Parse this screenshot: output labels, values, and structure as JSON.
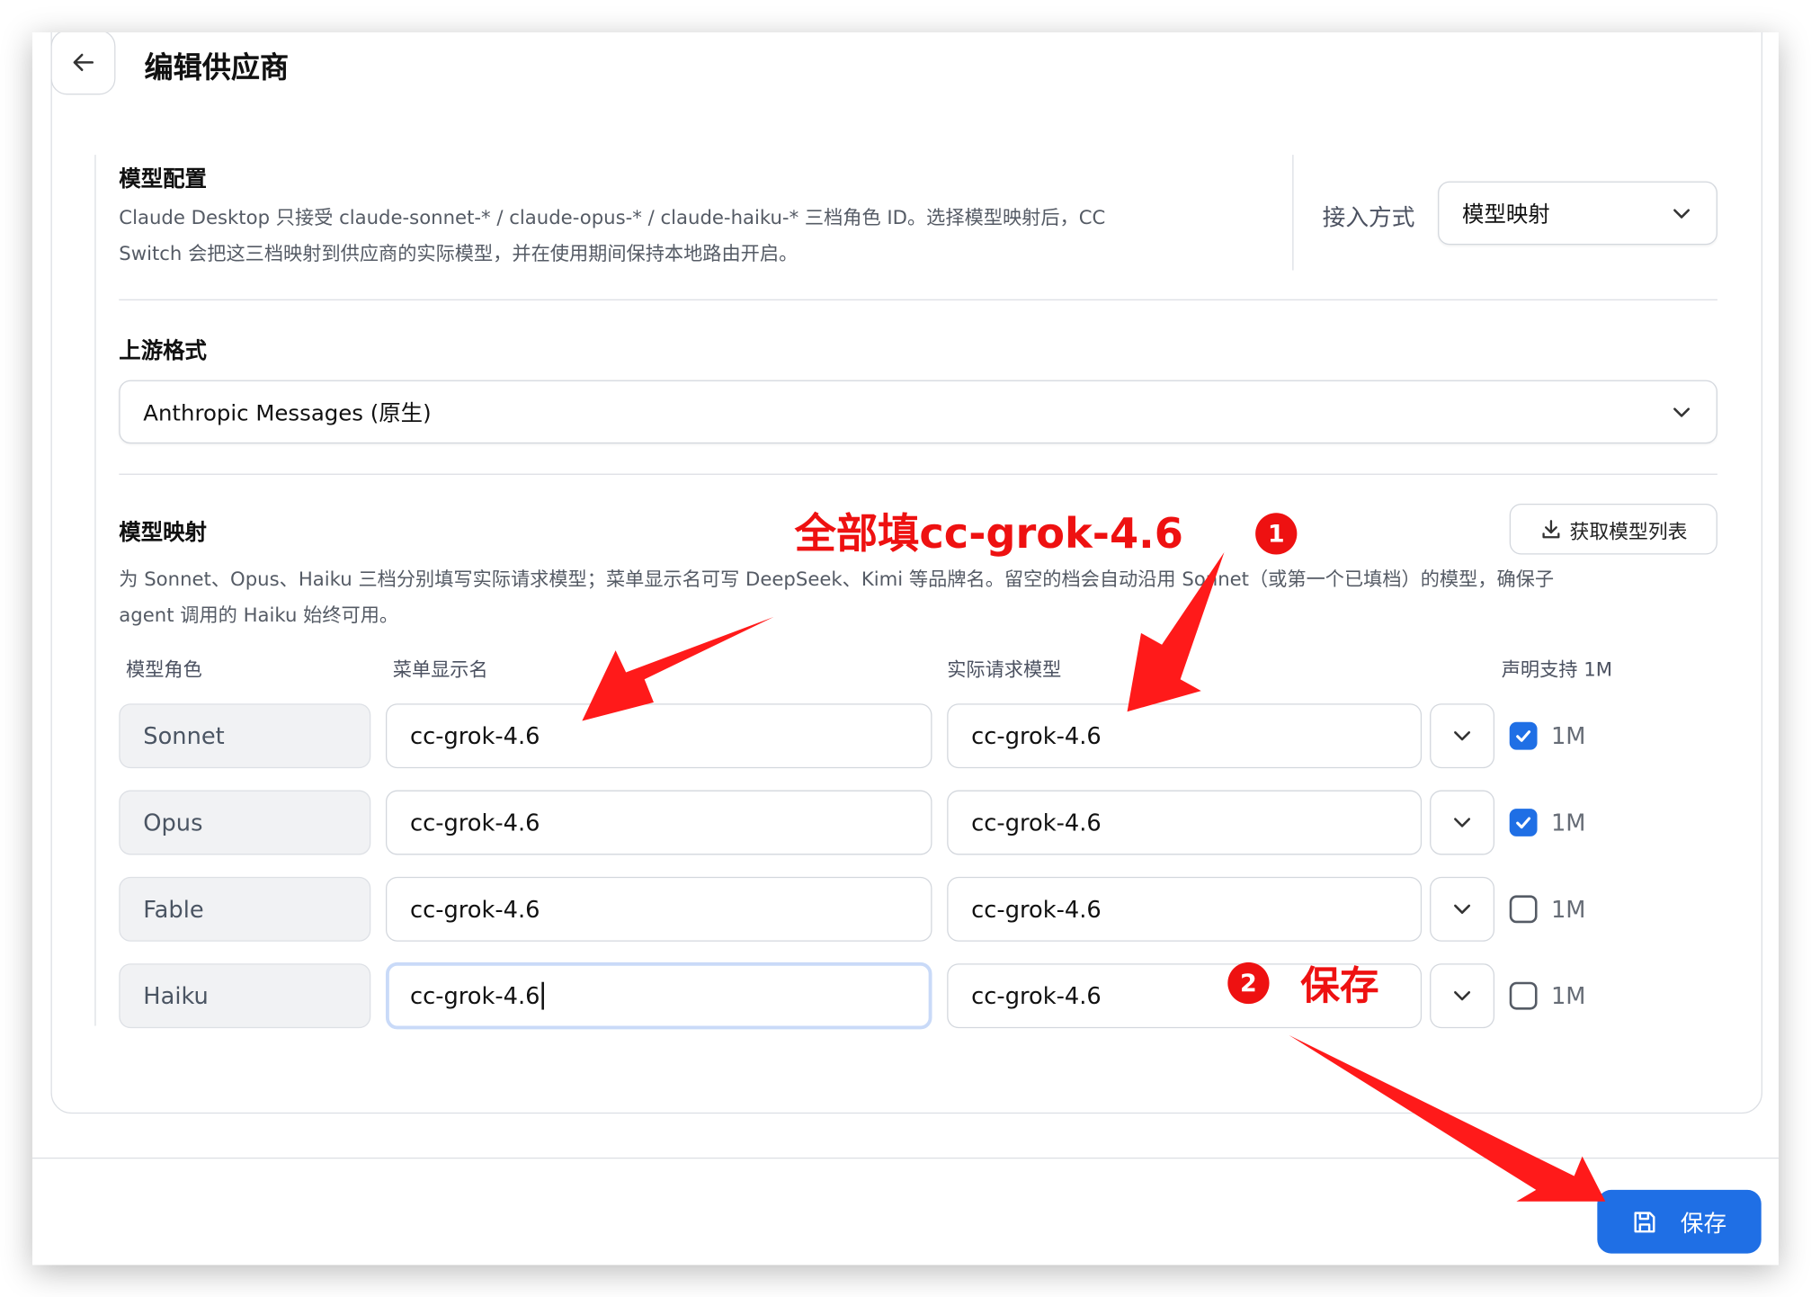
{
  "header": {
    "title": "编辑供应商"
  },
  "model_config": {
    "title": "模型配置",
    "desc_line1": "Claude Desktop 只接受 claude-sonnet-* / claude-opus-* / claude-haiku-* 三档角色 ID。选择模型映射后，CC",
    "desc_line2": "Switch 会把这三档映射到供应商的实际模型，并在使用期间保持本地路由开启。",
    "access_label": "接入方式",
    "access_value": "模型映射"
  },
  "upstream": {
    "title": "上游格式",
    "value": "Anthropic Messages (原生)"
  },
  "mapping": {
    "title": "模型映射",
    "fetch_label": "获取模型列表",
    "desc_line1": "为 Sonnet、Opus、Haiku 三档分别填写实际请求模型；菜单显示名可写 DeepSeek、Kimi 等品牌名。留空的档会自动沿用 Sonnet（或第一个已填档）的模型，确保子",
    "desc_line2": "agent 调用的 Haiku 始终可用。",
    "columns": {
      "role": "模型角色",
      "display": "菜单显示名",
      "actual": "实际请求模型",
      "support": "声明支持 1M"
    },
    "rows": [
      {
        "role": "Sonnet",
        "display": "cc-grok-4.6",
        "actual": "cc-grok-4.6",
        "checked": true,
        "check_label": "1M"
      },
      {
        "role": "Opus",
        "display": "cc-grok-4.6",
        "actual": "cc-grok-4.6",
        "checked": true,
        "check_label": "1M"
      },
      {
        "role": "Fable",
        "display": "cc-grok-4.6",
        "actual": "cc-grok-4.6",
        "checked": false,
        "check_label": "1M"
      },
      {
        "role": "Haiku",
        "display": "cc-grok-4.6",
        "actual": "cc-grok-4.6",
        "checked": false,
        "check_label": "1M"
      }
    ]
  },
  "footer": {
    "save_label": "保存"
  },
  "annotations": {
    "fill_all": "全部填cc-grok-4.6",
    "badge1": "1",
    "badge2": "2",
    "save_note": "保存"
  },
  "colors": {
    "accent": "#1f6fe5",
    "annotation": "#ee1111"
  },
  "icons": [
    "arrow-left-icon",
    "chevron-down-icon",
    "download-icon",
    "checkmark-icon",
    "save-disk-icon"
  ]
}
